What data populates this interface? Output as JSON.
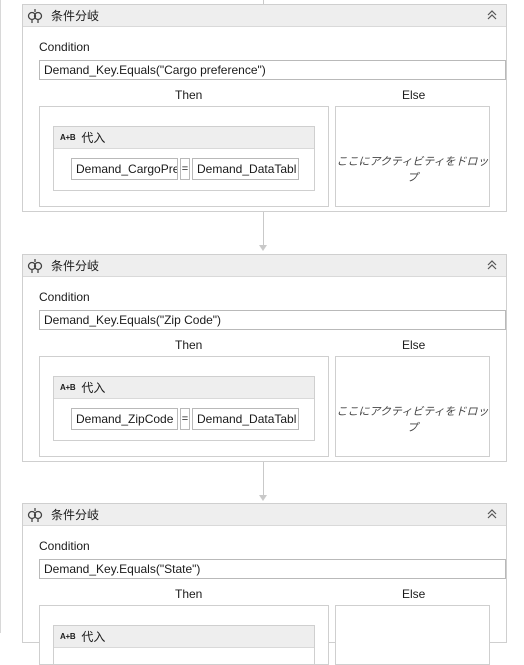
{
  "blocks": [
    {
      "title": "条件分岐",
      "condition_label": "Condition",
      "condition_value": "Demand_Key.Equals(\"Cargo preference\")",
      "then_label": "Then",
      "else_label": "Else",
      "assign": {
        "title": "代入",
        "icon_text": "A+B",
        "target": "Demand_CargoPre",
        "equals": "=",
        "value": "Demand_DataTabl"
      },
      "else_drop_text": "ここにアクティビティをドロップ"
    },
    {
      "title": "条件分岐",
      "condition_label": "Condition",
      "condition_value": "Demand_Key.Equals(\"Zip Code\")",
      "then_label": "Then",
      "else_label": "Else",
      "assign": {
        "title": "代入",
        "icon_text": "A+B",
        "target": "Demand_ZipCode",
        "equals": "=",
        "value": "Demand_DataTabl"
      },
      "else_drop_text": "ここにアクティビティをドロップ"
    },
    {
      "title": "条件分岐",
      "condition_label": "Condition",
      "condition_value": "Demand_Key.Equals(\"State\")",
      "then_label": "Then",
      "else_label": "Else",
      "assign": {
        "title": "代入",
        "icon_text": "A+B"
      }
    }
  ],
  "icons": {
    "if_icon": "if-activity-icon",
    "collapse": "collapse-chevron-up-icon"
  }
}
